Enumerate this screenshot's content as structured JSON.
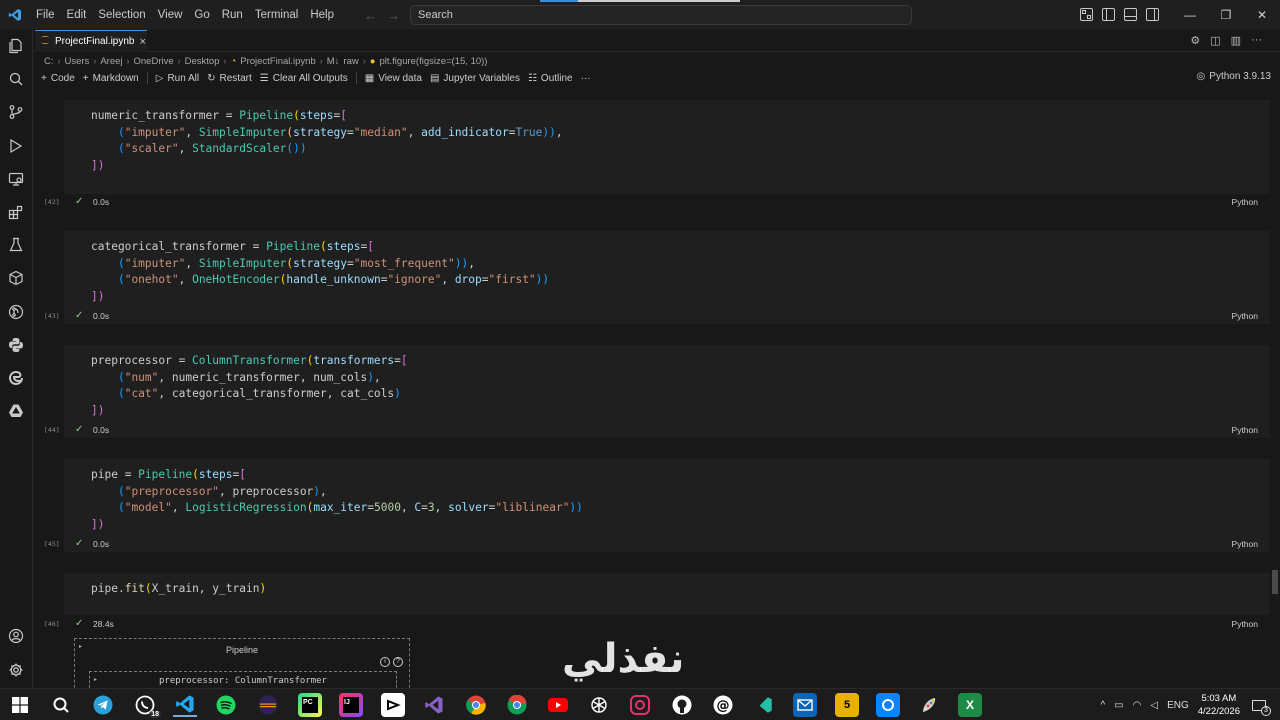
{
  "titlebar": {
    "menu": [
      "File",
      "Edit",
      "Selection",
      "View",
      "Go",
      "Run",
      "Terminal",
      "Help"
    ],
    "search_placeholder": "Search",
    "icons": [
      "vscode-logo-icon",
      "back-arrow-icon",
      "forward-arrow-icon",
      "toggle-primary-sidebar-icon",
      "toggle-panel-icon",
      "toggle-secondary-sidebar-icon",
      "customize-layout-icon",
      "minimize-icon",
      "restore-icon",
      "close-icon"
    ]
  },
  "activity_bar": {
    "icons": [
      "explorer-icon",
      "search-icon",
      "source-control-icon",
      "run-debug-icon",
      "remote-explorer-icon",
      "extensions-icon",
      "testing-icon",
      "containers-icon",
      "gitlens-icon",
      "python-icon",
      "edge-devtools-icon",
      "google-drive-icon",
      "accounts-icon",
      "manage-gear-icon"
    ]
  },
  "tab": {
    "label": "ProjectFinal.ipynb",
    "close": "×"
  },
  "breadcrumb": {
    "items": [
      "C:",
      "Users",
      "Areej",
      "OneDrive",
      "Desktop",
      "ProjectFinal.ipynb",
      "raw",
      "plt.figure(figsize=(15, 10))"
    ],
    "markdown_prefix": "M↓"
  },
  "toolbar": {
    "code": "Code",
    "markdown": "Markdown",
    "run_all": "Run All",
    "restart": "Restart",
    "clear_all_outputs": "Clear All Outputs",
    "view_data": "View data",
    "jupyter_variables": "Jupyter Variables",
    "outline": "Outline",
    "more": "···",
    "kernel": "Python 3.9.13"
  },
  "cells": [
    {
      "count": "[42]",
      "time": "0.0s",
      "lang": "Python"
    },
    {
      "count": "[43]",
      "time": "0.0s",
      "lang": "Python"
    },
    {
      "count": "[44]",
      "time": "0.0s",
      "lang": "Python"
    },
    {
      "count": "[45]",
      "time": "0.0s",
      "lang": "Python"
    },
    {
      "count": "[46]",
      "time": "28.4s",
      "lang": "Python"
    }
  ],
  "code": {
    "c1": {
      "l1_var": "numeric_transformer",
      "l1_eq": " = ",
      "l1_cls": "Pipeline",
      "l1_open": "(",
      "l1_par": "steps",
      "l1_eq2": "=",
      "l1_br": "[",
      "l2_a": "(",
      "l2_s1": "\"imputer\"",
      "l2_c": ", ",
      "l2_cls": "SimpleImputer",
      "l2_o": "(",
      "l2_p1": "strategy",
      "l2_e1": "=",
      "l2_s2": "\"median\"",
      "l2_c2": ", ",
      "l2_p2": "add_indicator",
      "l2_e2": "=",
      "l2_kw": "True",
      "l2_close": "))",
      "l2_end": ",",
      "l3_a": "(",
      "l3_s1": "\"scaler\"",
      "l3_c": ", ",
      "l3_cls": "StandardScaler",
      "l3_close": "())",
      "l4": "])"
    },
    "c2": {
      "l1_var": "categorical_transformer",
      "l1_eq": " = ",
      "l1_cls": "Pipeline",
      "l1_open": "(",
      "l1_par": "steps",
      "l1_eq2": "=",
      "l1_br": "[",
      "l2_a": "(",
      "l2_s1": "\"imputer\"",
      "l2_c": ", ",
      "l2_cls": "SimpleImputer",
      "l2_o": "(",
      "l2_p1": "strategy",
      "l2_e1": "=",
      "l2_s2": "\"most_frequent\"",
      "l2_close": "))",
      "l2_end": ",",
      "l3_a": "(",
      "l3_s1": "\"onehot\"",
      "l3_c": ", ",
      "l3_cls": "OneHotEncoder",
      "l3_o": "(",
      "l3_p1": "handle_unknown",
      "l3_e1": "=",
      "l3_s2": "\"ignore\"",
      "l3_c2": ", ",
      "l3_p2": "drop",
      "l3_e2": "=",
      "l3_s3": "\"first\"",
      "l3_close": "))",
      "l4": "])"
    },
    "c3": {
      "l1_var": "preprocessor",
      "l1_eq": " = ",
      "l1_cls": "ColumnTransformer",
      "l1_open": "(",
      "l1_par": "transformers",
      "l1_eq2": "=",
      "l1_br": "[",
      "l2_a": "(",
      "l2_s1": "\"num\"",
      "l2_rest": ", numeric_transformer, num_cols",
      "l2_close": ")",
      "l2_end": ",",
      "l3_a": "(",
      "l3_s1": "\"cat\"",
      "l3_rest": ", categorical_transformer, cat_cols",
      "l3_close": ")",
      "l4": "])"
    },
    "c4": {
      "l1_var": "pipe",
      "l1_eq": " = ",
      "l1_cls": "Pipeline",
      "l1_open": "(",
      "l1_par": "steps",
      "l1_eq2": "=",
      "l1_br": "[",
      "l2_a": "(",
      "l2_s1": "\"preprocessor\"",
      "l2_rest": ", preprocessor",
      "l2_close": ")",
      "l2_end": ",",
      "l3_a": "(",
      "l3_s1": "\"model\"",
      "l3_c": ", ",
      "l3_cls": "LogisticRegression",
      "l3_o": "(",
      "l3_p1": "max_iter",
      "l3_e1": "=",
      "l3_n1": "5000",
      "l3_c2": ", ",
      "l3_p2": "C",
      "l3_e2": "=",
      "l3_n2": "3",
      "l3_c3": ", ",
      "l3_p3": "solver",
      "l3_e3": "=",
      "l3_s2": "\"liblinear\"",
      "l3_close": "))",
      "l4": "])"
    },
    "c5": {
      "l1_obj": "pipe.",
      "l1_fn": "fit",
      "l1_open": "(",
      "l1_args": "X_train, y_train",
      "l1_close": ")"
    }
  },
  "output": {
    "pipeline_title": "Pipeline",
    "inner_title": "preprocessor: ColumnTransformer",
    "info1": "i",
    "info2": "?"
  },
  "watermark": "نفذلي",
  "taskbar": {
    "apps": [
      "windows-start-icon",
      "search-icon",
      "telegram-icon",
      "whatsapp-icon",
      "vscode-icon",
      "spotify-icon",
      "eclipse-icon",
      "pycharm-icon",
      "intellij-icon",
      "capcut-icon",
      "visual-studio-icon",
      "chrome-icon",
      "chrome-profile-icon",
      "youtube-icon",
      "chatgpt-icon",
      "instagram-icon",
      "github-icon",
      "threads-icon",
      "vscode-insiders-icon",
      "outlook-icon",
      "html5-icon",
      "bluesky-icon",
      "paint-icon",
      "excel-icon"
    ],
    "whatsapp_badge": "18",
    "five_label": "5",
    "tray": {
      "chevron": "^",
      "lang": "ENG",
      "time": "5:03 AM",
      "date": "4/22/2026",
      "notifications": "3"
    },
    "colors": {
      "telegram": "#2aa1da",
      "whatsapp": "#25d366",
      "vscode": "#23a9f2",
      "spotify": "#1ed760",
      "youtube": "#ff0000",
      "html5": "#e8b100",
      "excel": "#1d8a45"
    }
  }
}
